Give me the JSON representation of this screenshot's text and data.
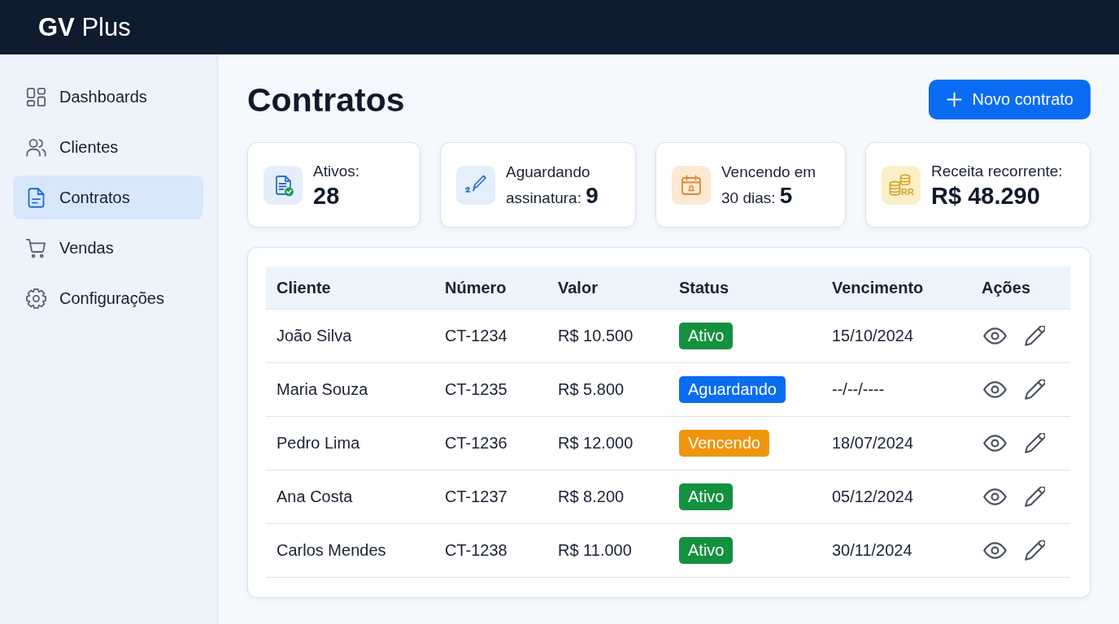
{
  "top_bar": {
    "logo": "**GV** Plus"
  },
  "sidebar": {
    "items": [
      {
        "label": "Dashboards",
        "selected": false
      },
      {
        "label": "Clientes",
        "selected": false
      },
      {
        "label": "Contratos",
        "selected": true
      },
      {
        "label": "Vendas",
        "selected": false
      },
      {
        "label": "Configurações",
        "selected": false
      }
    ]
  },
  "page": {
    "title": "Contratos",
    "new_button": "Novo contrato"
  },
  "stats": [
    {
      "kind": "stacked",
      "label": "Ativos:",
      "value": "28"
    },
    {
      "kind": "inline",
      "label": "Aguardando assinatura:",
      "value": "9"
    },
    {
      "kind": "inline",
      "label": "Vencendo em 30 dias:",
      "value": "5"
    },
    {
      "kind": "stacked",
      "label": "Receita recorrente:",
      "value": "R$ 48.290",
      "icon_text": "RR"
    }
  ],
  "table": {
    "columns": [
      "Cliente",
      "Número",
      "Valor",
      "Status",
      "Vencimento",
      "Ações"
    ],
    "rows": [
      {
        "cliente": "João Silva",
        "numero": "CT-1234",
        "valor": "R$ 10.500",
        "status": {
          "label": "Ativo",
          "color": "#14913f"
        },
        "vencimento": "15/10/2024"
      },
      {
        "cliente": "Maria Souza",
        "numero": "CT-1235",
        "valor": "R$ 5.800",
        "status": {
          "label": "Aguardando",
          "color": "#0a6cf0"
        },
        "vencimento": "--/--/----"
      },
      {
        "cliente": "Pedro Lima",
        "numero": "CT-1236",
        "valor": "R$ 12.000",
        "status": {
          "label": "Vencendo",
          "color": "#ee950d"
        },
        "vencimento": "18/07/2024"
      },
      {
        "cliente": "Ana Costa",
        "numero": "CT-1237",
        "valor": "R$ 8.200",
        "status": {
          "label": "Ativo",
          "color": "#14913f"
        },
        "vencimento": "05/12/2024"
      },
      {
        "cliente": "Carlos Mendes",
        "numero": "CT-1238",
        "valor": "R$ 11.000",
        "status": {
          "label": "Ativo",
          "color": "#14913f"
        },
        "vencimento": "30/11/2024"
      }
    ]
  }
}
